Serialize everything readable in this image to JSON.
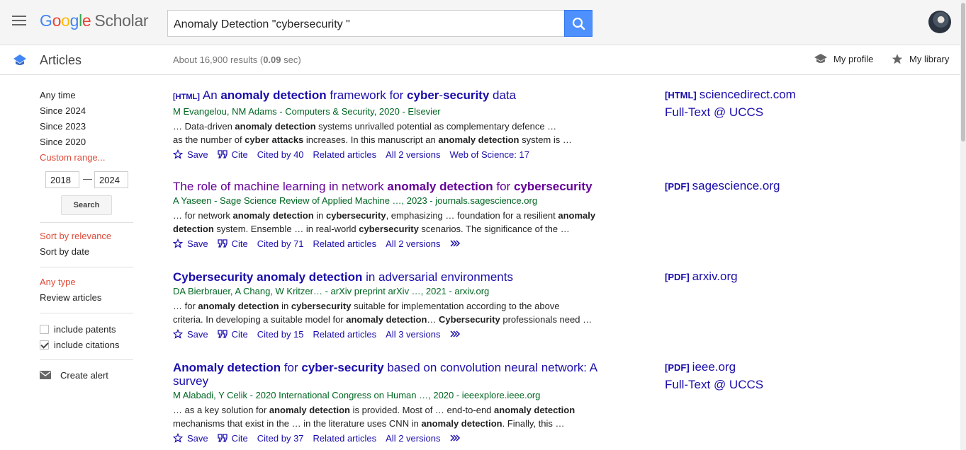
{
  "header": {
    "logo": {
      "g1": "G",
      "g2": "o",
      "g3": "o",
      "g4": "g",
      "g5": "l",
      "g6": "e",
      "scholar": "Scholar"
    },
    "search_query": "Anomaly Detection \"cybersecurity \""
  },
  "subbar": {
    "title": "Articles",
    "results_prefix": "About 16,900 results (",
    "results_time": "0.09",
    "results_suffix": " sec)",
    "my_profile": "My profile",
    "my_library": "My library"
  },
  "sidebar": {
    "time_filters": [
      "Any time",
      "Since 2024",
      "Since 2023",
      "Since 2020",
      "Custom range..."
    ],
    "range_from": "2018",
    "range_sep": "—",
    "range_to": "2024",
    "search_label": "Search",
    "sort_relevance": "Sort by relevance",
    "sort_date": "Sort by date",
    "any_type": "Any type",
    "review_articles": "Review articles",
    "include_patents": "include patents",
    "include_citations": "include citations",
    "create_alert": "Create alert"
  },
  "results": [
    {
      "type_tag": "[HTML]",
      "title_parts": [
        [
          "An ",
          false
        ],
        [
          "anomaly detection",
          true
        ],
        [
          " framework for ",
          false
        ],
        [
          "cyber",
          true
        ],
        [
          "-",
          false
        ],
        [
          "security",
          true
        ],
        [
          " data",
          false
        ]
      ],
      "authors": "M Evangelou, NM Adams - Computers & Security, 2020 - Elsevier",
      "snippet1": [
        [
          "… Data-driven ",
          false
        ],
        [
          "anomaly detection",
          true
        ],
        [
          " systems unrivalled potential as complementary defence …",
          false
        ]
      ],
      "snippet2": [
        [
          "as the number of ",
          false
        ],
        [
          "cyber attacks",
          true
        ],
        [
          " increases. In this manuscript an ",
          false
        ],
        [
          "anomaly detection",
          true
        ],
        [
          " system is …",
          false
        ]
      ],
      "save": "Save",
      "cite": "Cite",
      "cited_by": "Cited by 40",
      "related": "Related articles",
      "versions": "All 2 versions",
      "extra": "Web of Science: 17",
      "side": [
        {
          "tag": "[HTML]",
          "text": "sciencedirect.com"
        },
        {
          "tag": "",
          "text": "Full-Text @ UCCS"
        }
      ]
    },
    {
      "type_tag": "",
      "title_parts": [
        [
          "The role of machine learning in network ",
          false
        ],
        [
          "anomaly detection",
          true
        ],
        [
          " for ",
          false
        ],
        [
          "cybersecurity",
          true
        ]
      ],
      "authors": "A Yaseen - Sage Science Review of Applied Machine …, 2023 - journals.sagescience.org",
      "snippet1": [
        [
          "… for network ",
          false
        ],
        [
          "anomaly detection",
          true
        ],
        [
          " in ",
          false
        ],
        [
          "cybersecurity",
          true
        ],
        [
          ", emphasizing … foundation for a resilient ",
          false
        ],
        [
          "anomaly",
          true
        ]
      ],
      "snippet2": [
        [
          "detection",
          true
        ],
        [
          " system. Ensemble … in real-world ",
          false
        ],
        [
          "cybersecurity",
          true
        ],
        [
          " scenarios. The significance of the …",
          false
        ]
      ],
      "save": "Save",
      "cite": "Cite",
      "cited_by": "Cited by 71",
      "related": "Related articles",
      "versions": "All 2 versions",
      "extra": "",
      "side": [
        {
          "tag": "[PDF]",
          "text": "sagescience.org"
        }
      ]
    },
    {
      "type_tag": "",
      "title_parts": [
        [
          "Cybersecurity anomaly detection",
          true
        ],
        [
          " in adversarial environments",
          false
        ]
      ],
      "authors": "DA Bierbrauer, A Chang, W Kritzer… - arXiv preprint arXiv …, 2021 - arxiv.org",
      "snippet1": [
        [
          "… for ",
          false
        ],
        [
          "anomaly detection",
          true
        ],
        [
          " in ",
          false
        ],
        [
          "cybersecurity",
          true
        ],
        [
          " suitable for implementation according to the above",
          false
        ]
      ],
      "snippet2": [
        [
          "criteria. In developing a suitable model for ",
          false
        ],
        [
          "anomaly detection",
          true
        ],
        [
          "… ",
          false
        ],
        [
          "Cybersecurity",
          true
        ],
        [
          " professionals need …",
          false
        ]
      ],
      "save": "Save",
      "cite": "Cite",
      "cited_by": "Cited by 15",
      "related": "Related articles",
      "versions": "All 3 versions",
      "extra": "",
      "side": [
        {
          "tag": "[PDF]",
          "text": "arxiv.org"
        }
      ]
    },
    {
      "type_tag": "",
      "title_parts": [
        [
          "Anomaly detection",
          true
        ],
        [
          " for ",
          false
        ],
        [
          "cyber-security",
          true
        ],
        [
          " based on convolution neural network: A survey",
          false
        ]
      ],
      "authors": "M Alabadi, Y Celik - 2020 International Congress on Human …, 2020 - ieeexplore.ieee.org",
      "snippet1": [
        [
          "… as a key solution for ",
          false
        ],
        [
          "anomaly detection",
          true
        ],
        [
          " is provided. Most of … end-to-end ",
          false
        ],
        [
          "anomaly detection",
          true
        ]
      ],
      "snippet2": [
        [
          "mechanisms that exist in the … in the literature uses CNN in ",
          false
        ],
        [
          "anomaly detection",
          true
        ],
        [
          ". Finally, this …",
          false
        ]
      ],
      "save": "Save",
      "cite": "Cite",
      "cited_by": "Cited by 37",
      "related": "Related articles",
      "versions": "All 2 versions",
      "extra": "",
      "side": [
        {
          "tag": "[PDF]",
          "text": "ieee.org"
        },
        {
          "tag": "",
          "text": "Full-Text @ UCCS"
        }
      ]
    }
  ],
  "colors": {
    "link": "#1a0dab",
    "visited": "#660099",
    "green": "#006621",
    "active": "#dd4b39",
    "search_blue": "#4d90fe"
  },
  "icons": [
    "menu-icon",
    "search-icon",
    "scholar-cap-icon",
    "star-icon",
    "quote-icon",
    "envelope-icon",
    "double-chevron-icon"
  ]
}
